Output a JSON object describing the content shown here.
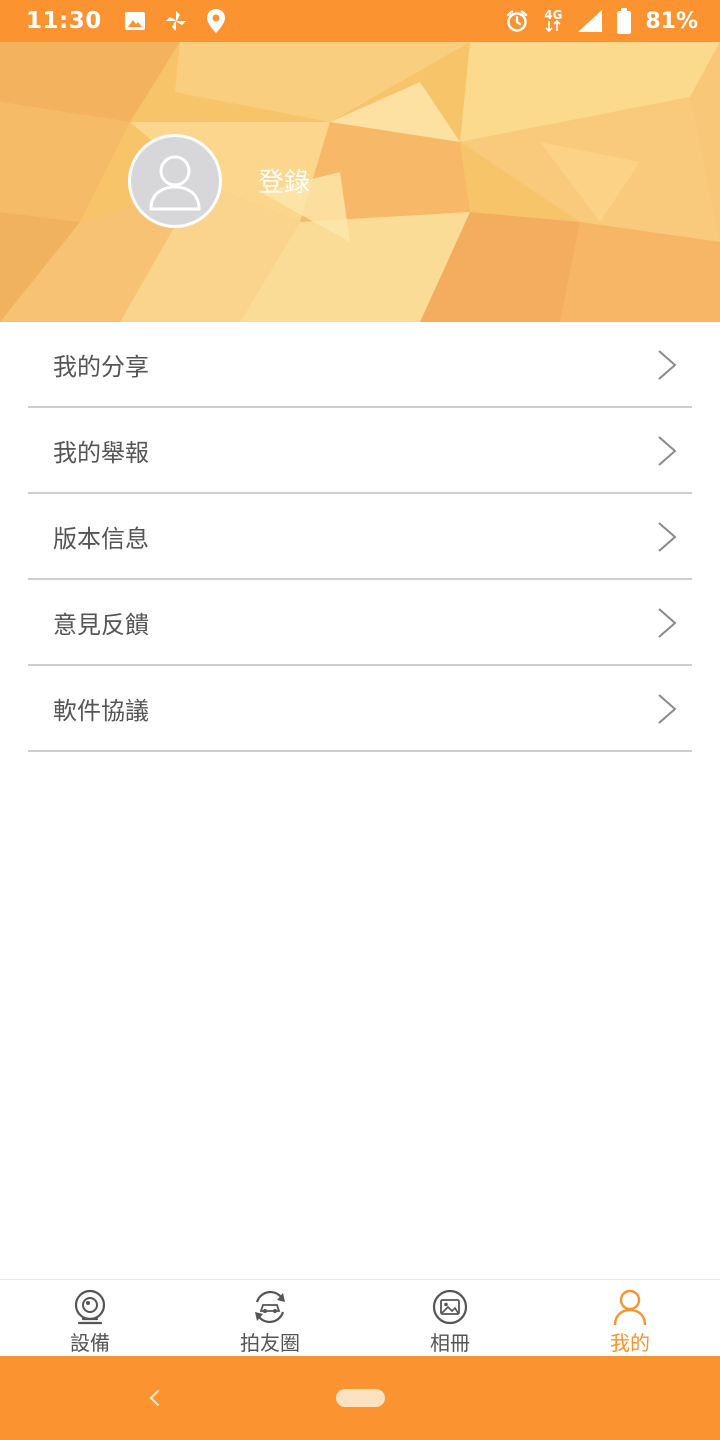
{
  "status_bar": {
    "time": "11:30",
    "network": "4G",
    "battery": "81%",
    "icons": [
      "image-icon",
      "pinwheel-icon",
      "location-icon",
      "alarm-icon",
      "signal-icon",
      "battery-icon"
    ]
  },
  "profile": {
    "login_label": "登錄",
    "avatar_icon": "user-avatar-icon"
  },
  "menu": {
    "items": [
      {
        "label": "我的分享"
      },
      {
        "label": "我的舉報"
      },
      {
        "label": "版本信息"
      },
      {
        "label": "意見反饋"
      },
      {
        "label": "軟件協議"
      }
    ]
  },
  "tabbar": {
    "tabs": [
      {
        "label": "設備",
        "icon": "camera-icon"
      },
      {
        "label": "拍友圈",
        "icon": "car-sync-icon"
      },
      {
        "label": "相冊",
        "icon": "album-icon"
      },
      {
        "label": "我的",
        "icon": "person-icon",
        "active": true
      }
    ]
  },
  "colors": {
    "accent": "#fb9331",
    "text": "#555555",
    "divider": "#cfcfcf"
  }
}
